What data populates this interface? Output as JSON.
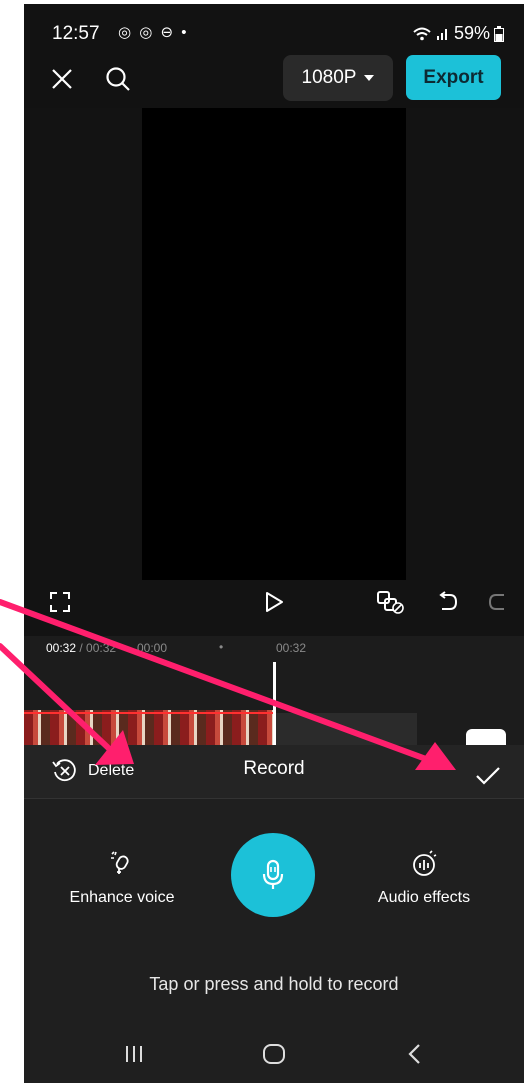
{
  "status_bar": {
    "time": "12:57",
    "notification_icons": "◎ ◎ ⊖ •",
    "battery": "59%"
  },
  "top_bar": {
    "resolution": "1080P",
    "export_label": "Export"
  },
  "timeline": {
    "current_time": "00:32",
    "separator": " / ",
    "total_time": "00:32",
    "tick_partial": "00:00",
    "tick_dot": "•",
    "tick_right": "00:32"
  },
  "record_panel": {
    "delete_label": "Delete",
    "title": "Record",
    "enhance_voice_label": "Enhance voice",
    "audio_effects_label": "Audio effects",
    "hint": "Tap or press and hold to record"
  },
  "colors": {
    "accent": "#1cc1d8",
    "annotation_arrow": "#ff1f6d",
    "background": "#121212"
  },
  "icons": [
    "close-icon",
    "search-icon",
    "fullscreen-icon",
    "play-icon",
    "keyframe-icon",
    "undo-icon",
    "redo-icon",
    "delete-icon",
    "check-icon",
    "enhance-voice-icon",
    "microphone-icon",
    "audio-effects-icon",
    "recents-icon",
    "home-icon",
    "back-icon"
  ]
}
